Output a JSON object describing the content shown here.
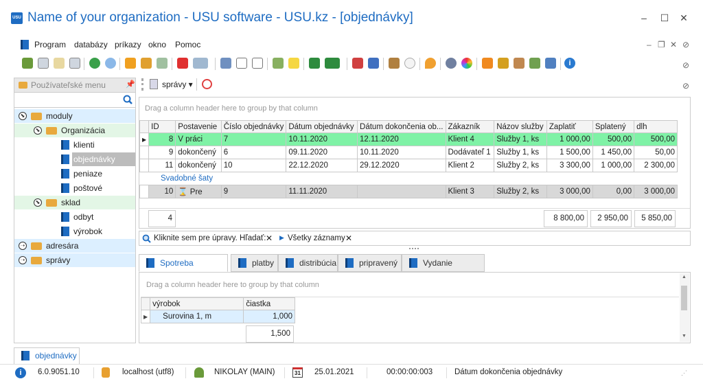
{
  "window": {
    "title": "Name of your organization - USU software - USU.kz - [objednávky]",
    "logo_text": "USU"
  },
  "menu": [
    "Program",
    "databázy",
    "príkazy",
    "okno",
    "Pomoc"
  ],
  "sidebar": {
    "title": "Používateľské menu",
    "tree": [
      {
        "label": "moduly",
        "level": 0,
        "kind": "folder",
        "expanded": true
      },
      {
        "label": "Organizácia",
        "level": 1,
        "kind": "folder",
        "expanded": true
      },
      {
        "label": "klienti",
        "level": 2,
        "kind": "item"
      },
      {
        "label": "objednávky",
        "level": 2,
        "kind": "item",
        "selected": true
      },
      {
        "label": "peniaze",
        "level": 2,
        "kind": "item"
      },
      {
        "label": "poštové",
        "level": 2,
        "kind": "item"
      },
      {
        "label": "sklad",
        "level": 1,
        "kind": "folder",
        "expanded": true
      },
      {
        "label": "odbyt",
        "level": 2,
        "kind": "item"
      },
      {
        "label": "výrobok",
        "level": 2,
        "kind": "item"
      },
      {
        "label": "adresára",
        "level": 0,
        "kind": "folder",
        "expanded": false
      },
      {
        "label": "správy",
        "level": 0,
        "kind": "folder",
        "expanded": false
      }
    ]
  },
  "reports_button": "správy",
  "grid": {
    "group_hint": "Drag a column header here to group by that column",
    "columns": [
      "ID",
      "Postavenie",
      "Číslo objednávky",
      "Dátum objednávky",
      "Dátum dokončenia ob...",
      "Zákazník",
      "Názov služby",
      "Zaplatiť",
      "Splatený",
      "dlh"
    ],
    "rows": [
      {
        "style": "green",
        "cells": [
          "8",
          "V práci",
          "7",
          "10.11.2020",
          "12.11.2020",
          "Klient 4",
          "Služby 1, ks",
          "1 000,00",
          "500,00",
          "500,00"
        ]
      },
      {
        "style": "white",
        "cells": [
          "9",
          "dokončený",
          "6",
          "09.11.2020",
          "10.11.2020",
          "Dodávateľ 1",
          "Služby 1, ks",
          "1 500,00",
          "1 450,00",
          "50,00"
        ]
      },
      {
        "style": "white",
        "cells": [
          "11",
          "dokončený",
          "10",
          "22.12.2020",
          "29.12.2020",
          "Klient 2",
          "Služby 2, ks",
          "3 300,00",
          "1 000,00",
          "2 300,00"
        ]
      }
    ],
    "note_row": "Svadobné šaty",
    "last_row": {
      "style": "gray",
      "cells": [
        "10",
        "Pre",
        "9",
        "11.11.2020",
        "",
        "Klient 3",
        "Služby 2, ks",
        "3 000,00",
        "0,00",
        "3 000,00"
      ]
    },
    "footer": {
      "count": "4",
      "zaplatit": "8 800,00",
      "splateny": "2 950,00",
      "dlh": "5 850,00"
    }
  },
  "filter": {
    "edit_text": "Kliknite sem pre úpravy. Hľadať:",
    "all_records": "Všetky záznamy"
  },
  "tabs": [
    "Spotreba materiálu",
    "platby",
    "distribúcia",
    "pripravený",
    "Vydanie klientovi"
  ],
  "subgrid": {
    "group_hint": "Drag a column header here to group by that column",
    "columns": [
      "výrobok",
      "čiastka"
    ],
    "rows": [
      [
        "Surovina 1, m",
        "1,000"
      ]
    ],
    "total": "1,500"
  },
  "bottom_tab": "objednávky",
  "status": {
    "version": "6.0.9051.10",
    "db": "localhost (utf8)",
    "user": "NIKOLAY (MAIN)",
    "calendar_day": "31",
    "date": "25.01.2021",
    "time": "00:00:00:003",
    "field": "Dátum dokončenia objednávky"
  }
}
